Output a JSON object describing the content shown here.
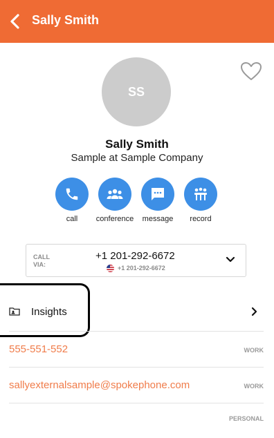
{
  "header": {
    "title": "Sally Smith"
  },
  "contact": {
    "initials": "SS",
    "name": "Sally Smith",
    "company": "Sample at Sample Company"
  },
  "actions": [
    {
      "label": "call",
      "icon": "phone-icon"
    },
    {
      "label": "conference",
      "icon": "group-icon"
    },
    {
      "label": "message",
      "icon": "chat-icon"
    },
    {
      "label": "record",
      "icon": "record-icon"
    }
  ],
  "call_via": {
    "label": "CALL VIA:",
    "number": "+1 201-292-6672",
    "sub_number": "+1 201-292-6672",
    "flag": "us-flag-icon"
  },
  "insights": {
    "label": "Insights"
  },
  "details": [
    {
      "value": "555-551-552",
      "type": "WORK"
    },
    {
      "value": "sallyexternalsample@spokephone.com",
      "type": "WORK"
    },
    {
      "value": "",
      "type": "PERSONAL"
    }
  ],
  "colors": {
    "header": "#ef6b34",
    "action": "#3d8fe6",
    "link": "#f07c4a"
  }
}
